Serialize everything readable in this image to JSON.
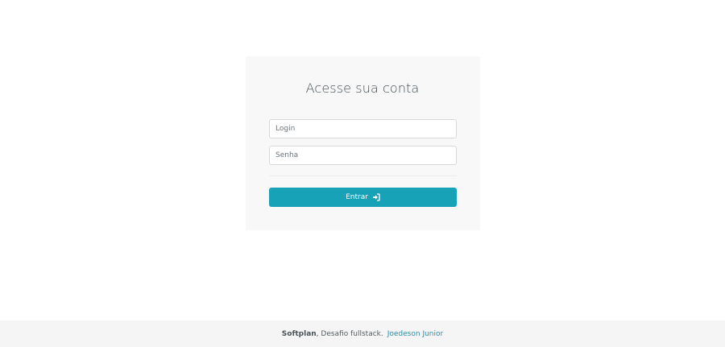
{
  "login_card": {
    "title": "Acesse sua conta",
    "login_placeholder": "Login",
    "password_placeholder": "Senha",
    "login_value": "",
    "password_value": "",
    "submit_label": "Entrar",
    "submit_icon": "sign-in-icon",
    "accent_color": "#17a2b8"
  },
  "footer": {
    "brand": "Softplan",
    "text": ", Desafio fullstack.",
    "author_link": "Joedeson Junior",
    "link_color": "#2b8fb0"
  }
}
